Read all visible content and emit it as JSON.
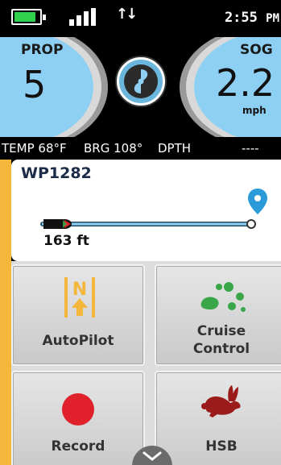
{
  "status": {
    "time": "2:55",
    "ampm": "PM",
    "battery_level": 0.85
  },
  "gauges": {
    "left": {
      "label": "PROP",
      "value": "5"
    },
    "right": {
      "label": "SOG",
      "value": "2.2",
      "unit": "mph"
    },
    "center_icon": "propeller-icon"
  },
  "info": {
    "temp": "TEMP 68°F",
    "brg": "BRG 108°",
    "dpth": "DPTH",
    "dpth_value": "----"
  },
  "waypoint": {
    "name": "WP1282",
    "distance": "163 ft",
    "progress": 0.05
  },
  "tiles": [
    {
      "label": "AutoPilot",
      "icon": "autopilot-icon"
    },
    {
      "label": "Cruise Control",
      "line1": "Cruise",
      "line2": "Control",
      "icon": "cruise-control-icon"
    },
    {
      "label": "Record",
      "icon": "record-icon"
    },
    {
      "label": "HSB",
      "icon": "rabbit-icon"
    }
  ],
  "colors": {
    "gauge_fill": "#8ed0f4",
    "accent": "#f4b73c",
    "record": "#e0212b",
    "rabbit": "#9b1b1b",
    "cruise": "#3aa64a",
    "waypoint_pin": "#2b9ad8"
  }
}
